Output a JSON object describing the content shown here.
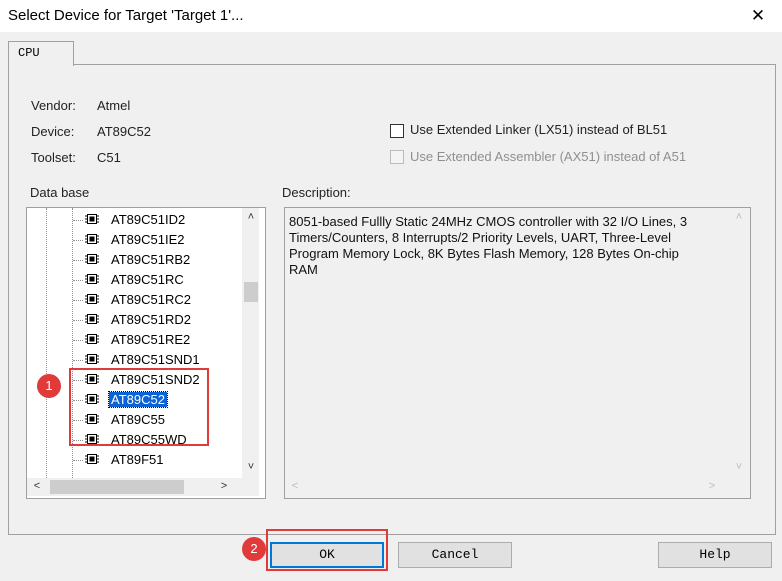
{
  "window": {
    "title": "Select Device for Target 'Target 1'...",
    "close_glyph": "✕"
  },
  "tabs": [
    {
      "label": "CPU"
    }
  ],
  "device_info": {
    "vendor_label": "Vendor:",
    "vendor_value": "Atmel",
    "device_label": "Device:",
    "device_value": "AT89C52",
    "toolset_label": "Toolset:",
    "toolset_value": "C51"
  },
  "options": {
    "extended_linker": {
      "label": "Use Extended Linker (LX51) instead of BL51",
      "checked": false,
      "enabled": true
    },
    "extended_assembler": {
      "label": "Use Extended Assembler (AX51) instead of A51",
      "checked": false,
      "enabled": false
    }
  },
  "database": {
    "label": "Data base",
    "items": [
      {
        "label": "AT89C51ID2",
        "selected": false
      },
      {
        "label": "AT89C51IE2",
        "selected": false
      },
      {
        "label": "AT89C51RB2",
        "selected": false
      },
      {
        "label": "AT89C51RC",
        "selected": false
      },
      {
        "label": "AT89C51RC2",
        "selected": false
      },
      {
        "label": "AT89C51RD2",
        "selected": false
      },
      {
        "label": "AT89C51RE2",
        "selected": false
      },
      {
        "label": "AT89C51SND1",
        "selected": false
      },
      {
        "label": "AT89C51SND2",
        "selected": false
      },
      {
        "label": "AT89C52",
        "selected": true
      },
      {
        "label": "AT89C55",
        "selected": false
      },
      {
        "label": "AT89C55WD",
        "selected": false
      },
      {
        "label": "AT89F51",
        "selected": false
      }
    ],
    "scroll": {
      "up": "˄",
      "down": "˅",
      "left": "<",
      "right": ">"
    }
  },
  "description": {
    "label": "Description:",
    "text": "8051-based Fullly Static 24MHz CMOS controller with 32  I/O Lines, 3 Timers/Counters, 8 Interrupts/2 Priority Levels, UART, Three-Level Program Memory Lock, 8K Bytes Flash Memory, 128 Bytes On-chip RAM"
  },
  "annotations": {
    "badge1": "1",
    "badge2": "2",
    "accent_color": "#e03a3a"
  },
  "buttons": {
    "ok": "OK",
    "cancel": "Cancel",
    "help": "Help"
  }
}
